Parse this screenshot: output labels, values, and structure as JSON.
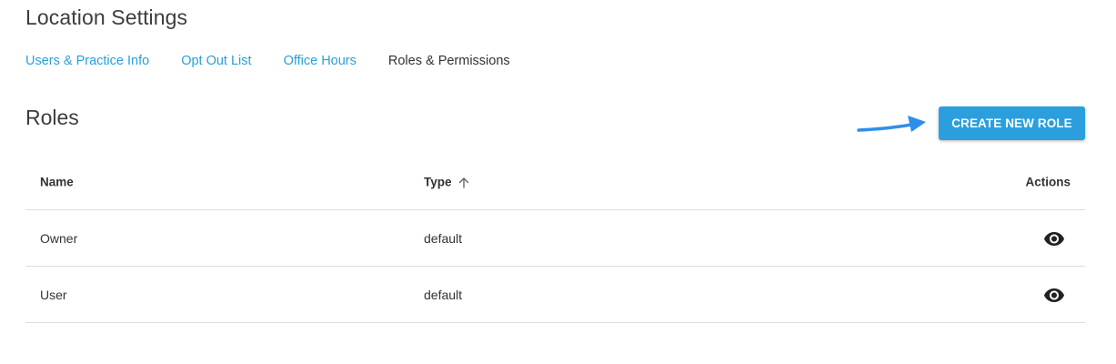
{
  "page": {
    "title": "Location Settings"
  },
  "tabs": [
    {
      "label": "Users & Practice Info"
    },
    {
      "label": "Opt Out List"
    },
    {
      "label": "Office Hours"
    },
    {
      "label": "Roles & Permissions"
    }
  ],
  "roles": {
    "title": "Roles",
    "create_button_label": "CREATE NEW ROLE",
    "accent_color": "#2b9fde",
    "arrow_color": "#2f8fe8"
  },
  "table": {
    "columns": {
      "name": "Name",
      "type": "Type",
      "actions": "Actions"
    },
    "sort_icon": "arrow-up-icon",
    "rows": [
      {
        "name": "Owner",
        "type": "default",
        "action_icon": "eye-icon"
      },
      {
        "name": "User",
        "type": "default",
        "action_icon": "eye-icon"
      }
    ]
  }
}
